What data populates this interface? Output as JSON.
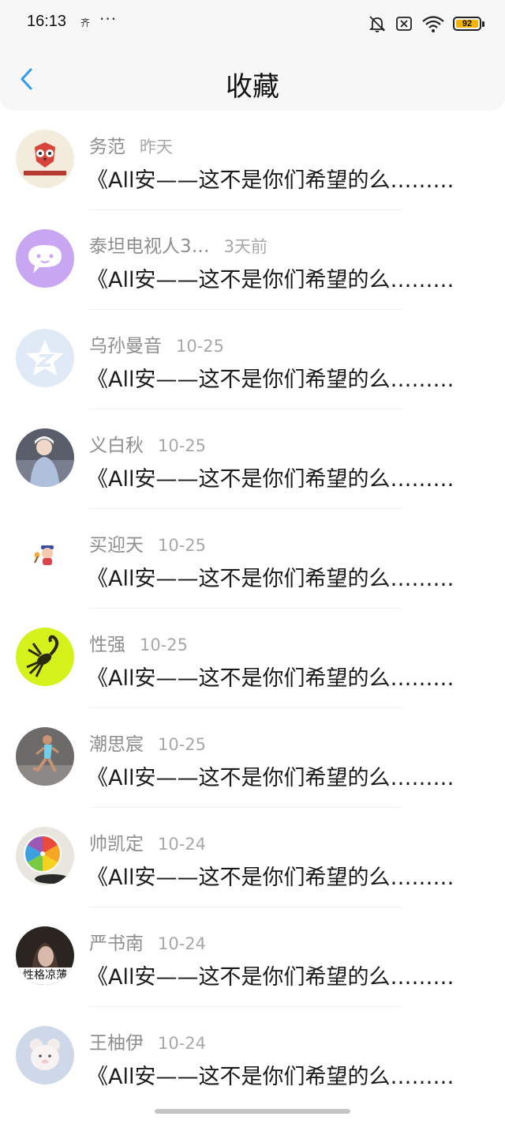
{
  "status_bar": {
    "time": "16:13",
    "small_icon_glyph": "齐",
    "dots": "···",
    "battery_level": "92",
    "icons": [
      "bell-muted-icon",
      "sim-error-icon",
      "wifi-icon",
      "battery-icon"
    ]
  },
  "header": {
    "title": "收藏",
    "back_icon": "chevron-left-icon",
    "accent_color": "#2f9bf0"
  },
  "favorites": [
    {
      "name": "务范",
      "date": "昨天",
      "message": "《All安——这不是你们希望的么………",
      "avatar": "owl-logo-avatar"
    },
    {
      "name": "泰坦电视人3…",
      "date": "3天前",
      "message": "《All安——这不是你们希望的么………",
      "avatar": "chat-bubble-avatar"
    },
    {
      "name": "乌孙曼音",
      "date": "10-25",
      "message": "《All安——这不是你们希望的么………",
      "avatar": "qq-star-avatar"
    },
    {
      "name": "义白秋",
      "date": "10-25",
      "message": "《All安——这不是你们希望的么………",
      "avatar": "photo-avatar"
    },
    {
      "name": "买迎天",
      "date": "10-25",
      "message": "《All安——这不是你们希望的么………",
      "avatar": "cartoon-avatar"
    },
    {
      "name": "性强",
      "date": "10-25",
      "message": "《All安——这不是你们希望的么………",
      "avatar": "scorpion-avatar"
    },
    {
      "name": "潮思宸",
      "date": "10-25",
      "message": "《All安——这不是你们希望的么………",
      "avatar": "runner-avatar"
    },
    {
      "name": "帅凯定",
      "date": "10-24",
      "message": "《All安——这不是你们希望的么………",
      "avatar": "citrus-avatar"
    },
    {
      "name": "严书南",
      "date": "10-24",
      "message": "《All安——这不是你们希望的么………",
      "avatar": "portrait-avatar",
      "avatar_caption": "性格凉薄"
    },
    {
      "name": "王柚伊",
      "date": "10-24",
      "message": "《All安——这不是你们希望的么………",
      "avatar": "plush-toy-avatar"
    }
  ]
}
